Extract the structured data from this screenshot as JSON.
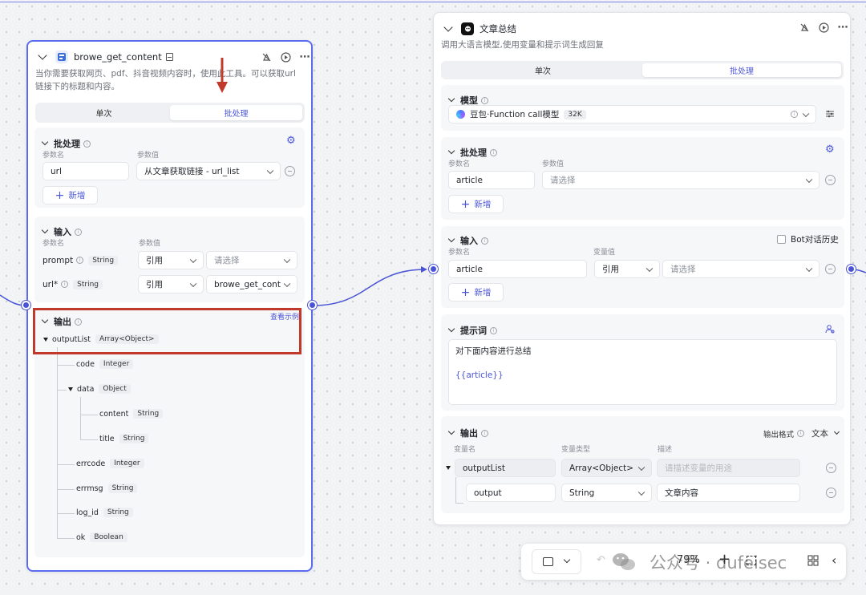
{
  "node1": {
    "title": "browe_get_content",
    "description": "当你需要获取网页、pdf、抖音视频内容时，使用此工具。可以获取url链接下的标题和内容。",
    "tabs": [
      "单次",
      "批处理"
    ],
    "batch": {
      "title": "批处理",
      "col_name": "参数名",
      "col_value": "参数值",
      "param_name": "url",
      "param_value": "从文章获取链接 - url_list",
      "add_label": "新增"
    },
    "input": {
      "title": "输入",
      "col_name": "参数名",
      "col_value": "参数值",
      "rows": [
        {
          "name": "prompt",
          "type": "String",
          "mode": "引用",
          "value": "请选择"
        },
        {
          "name": "url*",
          "type": "String",
          "mode": "引用",
          "value": "browe_get_cont"
        }
      ]
    },
    "output": {
      "title": "输出",
      "example_link": "查看示例",
      "root": {
        "name": "outputList",
        "type": "Array<Object>"
      },
      "children": [
        {
          "name": "code",
          "type": "Integer"
        },
        {
          "name": "data",
          "type": "Object"
        },
        {
          "name": "content",
          "type": "String"
        },
        {
          "name": "title",
          "type": "String"
        },
        {
          "name": "errcode",
          "type": "Integer"
        },
        {
          "name": "errmsg",
          "type": "String"
        },
        {
          "name": "log_id",
          "type": "String"
        },
        {
          "name": "ok",
          "type": "Boolean"
        }
      ]
    }
  },
  "node2": {
    "title": "文章总结",
    "description": "调用大语言模型,使用变量和提示词生成回复",
    "tabs": [
      "单次",
      "批处理"
    ],
    "model": {
      "title": "模型",
      "name": "豆包·Function call模型",
      "context": "32K"
    },
    "batch": {
      "title": "批处理",
      "col_name": "参数名",
      "col_value": "参数值",
      "param_name": "article",
      "param_value": "请选择",
      "add_label": "新增"
    },
    "input": {
      "title": "输入",
      "bot_history": "Bot对话历史",
      "col_name": "参数名",
      "col_value": "变量值",
      "param_name": "article",
      "mode": "引用",
      "value": "请选择",
      "add_label": "新增"
    },
    "prompt": {
      "title": "提示词",
      "line1": "对下面内容进行总结",
      "line2": "{{article}}"
    },
    "output": {
      "title": "输出",
      "format_label": "输出格式",
      "format_value": "文本",
      "col_name": "变量名",
      "col_type": "变量类型",
      "col_desc": "描述",
      "rows": [
        {
          "name": "outputList",
          "type": "Array<Object>",
          "desc": "请描述变量的用途"
        },
        {
          "name": "output",
          "type": "String",
          "desc": "文章内容"
        }
      ]
    }
  },
  "toolbar": {
    "zoom": "79%"
  },
  "watermark": "公众号 · dufeisec",
  "colors": {
    "accent": "#4a55d6",
    "annotation_red": "#c0392b",
    "node_border": "#5b6cf0"
  }
}
